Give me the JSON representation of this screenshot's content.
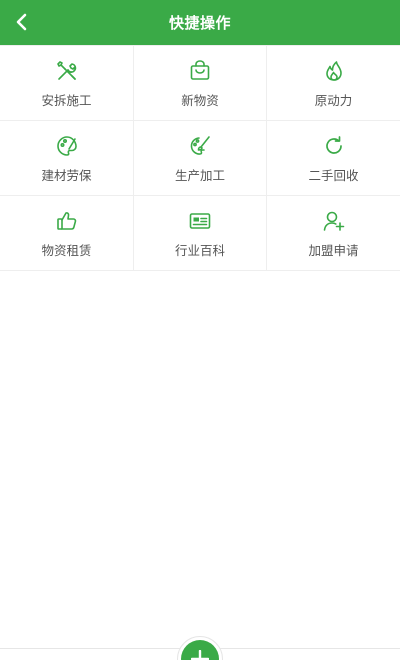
{
  "header": {
    "title": "快捷操作",
    "back_icon": "chevron-left-icon"
  },
  "colors": {
    "brand": "#3aaa47",
    "label": "#555555",
    "divider": "#eeeeee"
  },
  "grid": {
    "items": [
      {
        "label": "安拆施工",
        "icon": "tools-icon"
      },
      {
        "label": "新物资",
        "icon": "shopping-bag-icon"
      },
      {
        "label": "原动力",
        "icon": "flame-icon"
      },
      {
        "label": "建材劳保",
        "icon": "palette-icon"
      },
      {
        "label": "生产加工",
        "icon": "palette-brush-icon"
      },
      {
        "label": "二手回收",
        "icon": "refresh-icon"
      },
      {
        "label": "物资租赁",
        "icon": "thumbs-up-icon"
      },
      {
        "label": "行业百科",
        "icon": "id-card-icon"
      },
      {
        "label": "加盟申请",
        "icon": "user-add-icon"
      }
    ]
  },
  "fab": {
    "icon": "plus-icon"
  }
}
